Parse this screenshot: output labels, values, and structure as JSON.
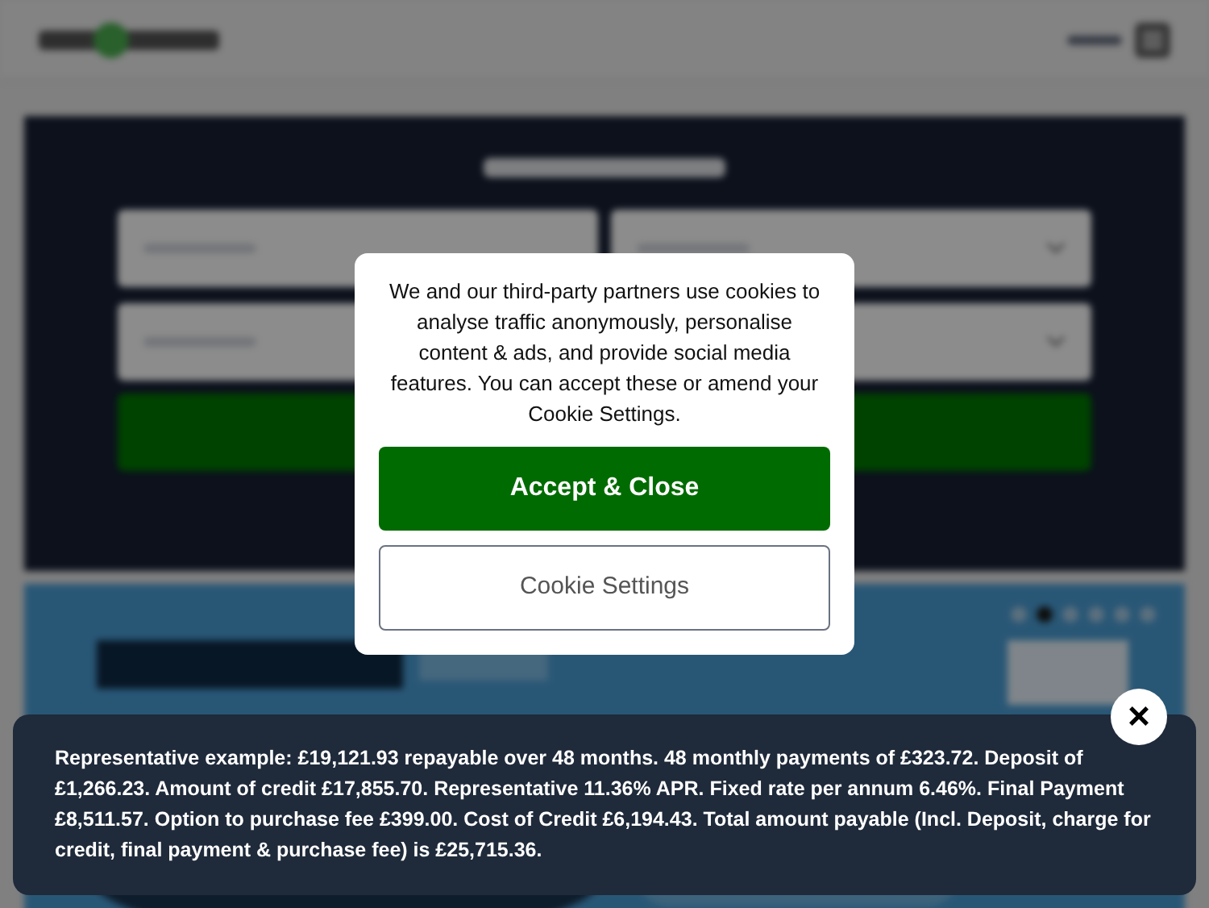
{
  "search": {
    "fields": [
      {
        "kind": "input"
      },
      {
        "kind": "select"
      },
      {
        "kind": "input"
      },
      {
        "kind": "select"
      }
    ]
  },
  "banner": {
    "kind": "picture",
    "dots": [
      {
        "selected": false
      },
      {
        "selected": true
      },
      {
        "selected": false
      },
      {
        "selected": false
      },
      {
        "selected": false
      },
      {
        "selected": false
      }
    ]
  },
  "cookie_dialog": {
    "message": "We and our third-party partners use cookies to analyse traffic anonymously, personalise content & ads, and provide social media features. You can accept these or amend your Cookie Settings.",
    "buttons": [
      {
        "kind": "primary",
        "label": "Accept & Close"
      },
      {
        "kind": "secondary",
        "label": "Cookie Settings"
      }
    ]
  },
  "finance_notice": {
    "text": "Representative example: £19,121.93 repayable over 48 months. 48 monthly payments of £323.72. Deposit of £1,266.23. Amount of credit £17,855.70. Representative 11.36% APR. Fixed rate per annum 6.46%. Final Payment £8,511.57. Option to purchase fee £399.00. Cost of Credit £6,194.43. Total amount payable (Incl. Deposit, charge for credit, final payment & purchase fee) is £25,715.36.",
    "close_label": "×"
  }
}
